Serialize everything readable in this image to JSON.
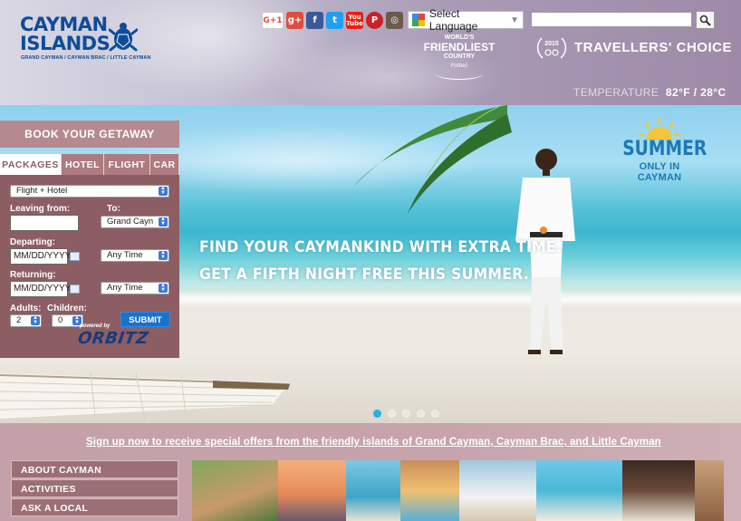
{
  "header": {
    "logo": {
      "line1": "CAYMAN",
      "line2": "ISLANDS",
      "tagline": "GRAND CAYMAN / CAYMAN BRAC / LITTLE CAYMAN"
    },
    "social": [
      {
        "name": "google-plus-one",
        "label": "G+1"
      },
      {
        "name": "google-plus",
        "label": "g+"
      },
      {
        "name": "facebook",
        "label": "f"
      },
      {
        "name": "twitter",
        "label": "t"
      },
      {
        "name": "youtube",
        "label": "You Tube"
      },
      {
        "name": "pinterest",
        "label": "P"
      },
      {
        "name": "instagram",
        "label": "◎"
      }
    ],
    "language": {
      "label": "Select Language"
    },
    "search": {
      "placeholder": ""
    },
    "award1": {
      "line1": "WORLD'S",
      "line2": "FRIENDLIEST",
      "line3": "COUNTRY",
      "source": "Forbes"
    },
    "award2": {
      "year": "2015",
      "text": "TRAVELLERS' CHOICE"
    },
    "temperature": {
      "label": "TEMPERATURE",
      "value": "82°F / 28°C"
    }
  },
  "hero": {
    "line1": "FIND YOUR CAYMANKIND WITH EXTRA TIME.",
    "line2": "GET A FIFTH NIGHT FREE THIS SUMMER.",
    "badge_line1": "SUMMER",
    "badge_line2": "ONLY IN CAYMAN",
    "slides": 5,
    "active_slide": 1
  },
  "booking": {
    "title": "BOOK YOUR GETAWAY",
    "tabs": [
      "PACKAGES",
      "HOTEL",
      "FLIGHT",
      "CAR"
    ],
    "active_tab": "PACKAGES",
    "package_type": "Flight + Hotel",
    "leaving_label": "Leaving from:",
    "leaving_value": "",
    "to_label": "To:",
    "to_value": "Grand Cayn",
    "departing_label": "Departing:",
    "departing_value": "MM/DD/YYYY",
    "departing_time": "Any Time",
    "returning_label": "Returning:",
    "returning_value": "MM/DD/YYYY",
    "returning_time": "Any Time",
    "adults_label": "Adults:",
    "adults_value": "2",
    "children_label": "Children:",
    "children_value": "0",
    "submit_label": "SUBMIT",
    "powered_by": "powered by",
    "provider": "ORBITZ"
  },
  "lower": {
    "signup": "Sign up now to receive special offers from the friendly islands of Grand Cayman, Cayman Brac, and Little Cayman",
    "nav": [
      "ABOUT CAYMAN",
      "ACTIVITIES",
      "ASK A LOCAL"
    ]
  },
  "colors": {
    "brand_blue": "#0d4c99",
    "mauve": "#8c5e63",
    "accent_cyan": "#1fb4e0"
  }
}
